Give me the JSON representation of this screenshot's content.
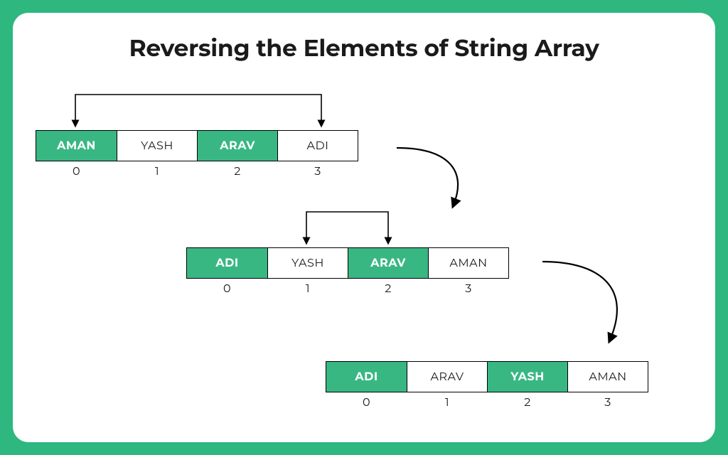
{
  "title": "Reversing the Elements of String Array",
  "colors": {
    "green": "#39b783",
    "bg": "#2eb77f"
  },
  "steps": [
    {
      "cells": [
        "AMAN",
        "YASH",
        "ARAV",
        "ADI"
      ],
      "highlight": [
        true,
        false,
        true,
        false
      ],
      "indices": [
        "0",
        "1",
        "2",
        "3"
      ]
    },
    {
      "cells": [
        "ADI",
        "YASH",
        "ARAV",
        "AMAN"
      ],
      "highlight": [
        true,
        false,
        true,
        false
      ],
      "indices": [
        "0",
        "1",
        "2",
        "3"
      ]
    },
    {
      "cells": [
        "ADI",
        "ARAV",
        "YASH",
        "AMAN"
      ],
      "highlight": [
        true,
        false,
        true,
        false
      ],
      "indices": [
        "0",
        "1",
        "2",
        "3"
      ]
    }
  ]
}
